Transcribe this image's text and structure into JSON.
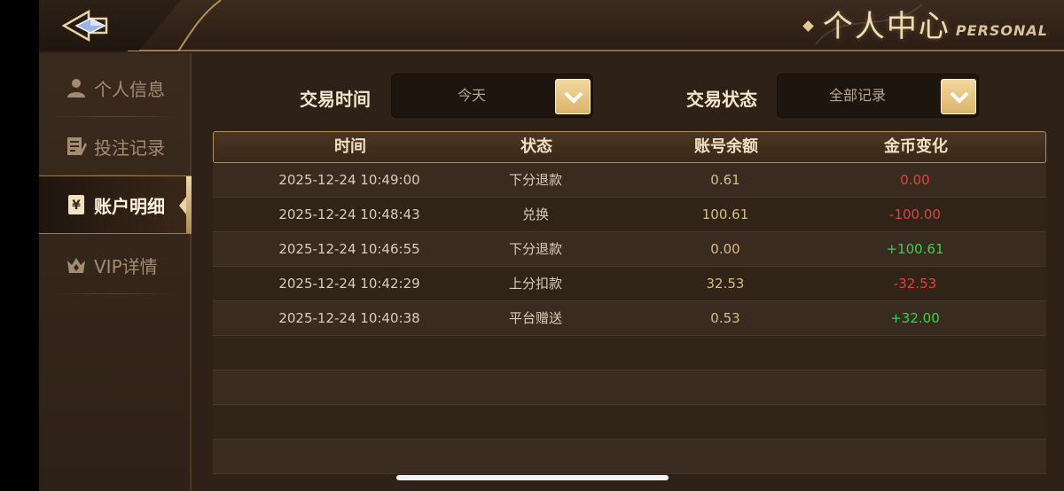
{
  "header": {
    "title_cn": "个人中心",
    "title_en": "PERSONAL"
  },
  "sidebar": {
    "items": [
      {
        "label": "个人信息",
        "icon": "user-icon",
        "active": false
      },
      {
        "label": "投注记录",
        "icon": "edit-note-icon",
        "active": false
      },
      {
        "label": "账户明细",
        "icon": "ledger-yen-icon",
        "active": true
      },
      {
        "label": "VIP详情",
        "icon": "crown-icon",
        "active": false
      }
    ]
  },
  "filters": {
    "time_label": "交易时间",
    "time_value": "今天",
    "status_label": "交易状态",
    "status_value": "全部记录"
  },
  "table": {
    "headers": [
      "时间",
      "状态",
      "账号余额",
      "金币变化"
    ],
    "rows": [
      {
        "time": "2025-12-24 10:49:00",
        "status": "下分退款",
        "balance": "0.61",
        "change": "0.00"
      },
      {
        "time": "2025-12-24 10:48:43",
        "status": "兑换",
        "balance": "100.61",
        "change": "-100.00"
      },
      {
        "time": "2025-12-24 10:46:55",
        "status": "下分退款",
        "balance": "0.00",
        "change": "+100.61"
      },
      {
        "time": "2025-12-24 10:42:29",
        "status": "上分扣款",
        "balance": "32.53",
        "change": "-32.53"
      },
      {
        "time": "2025-12-24 10:40:38",
        "status": "平台赠送",
        "balance": "0.53",
        "change": "+32.00"
      }
    ],
    "empty_rows": 4
  },
  "colors": {
    "positive": "#37d24c",
    "negative": "#e2423f",
    "accent_gold": "#d9b46c"
  }
}
